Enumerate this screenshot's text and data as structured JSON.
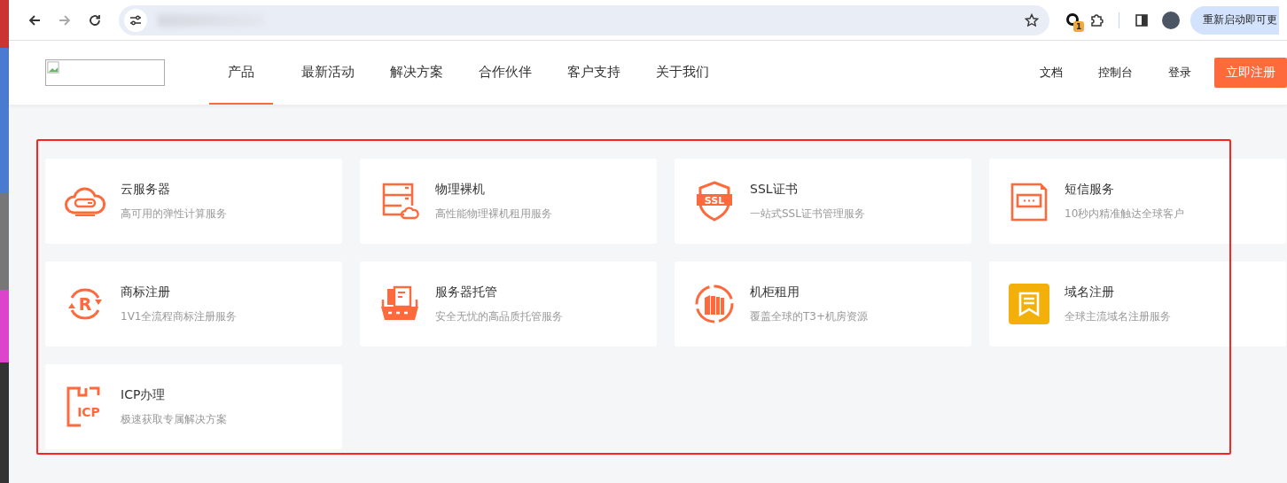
{
  "browser": {
    "extension_badge": "1",
    "restart_button": "重新启动即可更"
  },
  "header": {
    "nav": [
      {
        "label": "产品",
        "selected": true
      },
      {
        "label": "最新活动",
        "selected": false
      },
      {
        "label": "解决方案",
        "selected": false
      },
      {
        "label": "合作伙伴",
        "selected": false
      },
      {
        "label": "客户支持",
        "selected": false
      },
      {
        "label": "关于我们",
        "selected": false
      }
    ],
    "links": [
      "文档",
      "控制台",
      "登录"
    ],
    "signup_button": "立即注册"
  },
  "products": [
    {
      "kind": "cloud",
      "title": "云服务器",
      "description": "高可用的弹性计算服务"
    },
    {
      "kind": "server",
      "title": "物理裸机",
      "description": "高性能物理裸机租用服务"
    },
    {
      "kind": "shield",
      "title": "SSL证书",
      "description": "一站式SSL证书管理服务",
      "icon_text": "SSL"
    },
    {
      "kind": "message",
      "title": "短信服务",
      "description": "10秒内精准触达全球客户"
    },
    {
      "kind": "cycle",
      "title": "商标注册",
      "description": "1V1全流程商标注册服务",
      "icon_text": "R"
    },
    {
      "kind": "tray",
      "title": "服务器托管",
      "description": "安全无忧的高品质托管服务"
    },
    {
      "kind": "rack",
      "title": "机柜租用",
      "description": "覆盖全球的T3+机房资源"
    },
    {
      "kind": "domain",
      "title": "域名注册",
      "description": "全球主流域名注册服务"
    },
    {
      "kind": "frame",
      "title": "ICP办理",
      "description": "极速获取专属解决方案",
      "icon_text": "ICP"
    }
  ]
}
